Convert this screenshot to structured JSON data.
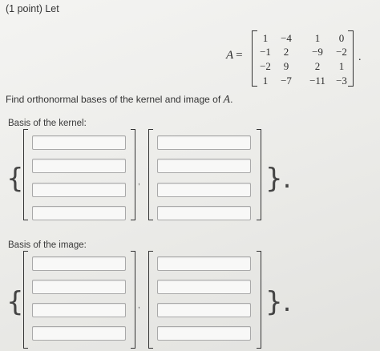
{
  "problem": {
    "header": "(1 point) Let",
    "matrix_name": "A",
    "equals": "=",
    "matrix": [
      [
        "1",
        "−4",
        "1",
        "0"
      ],
      [
        "−1",
        "2",
        "−9",
        "−2"
      ],
      [
        "−2",
        "9",
        "2",
        "1"
      ],
      [
        "1",
        "−7",
        "−11",
        "−3"
      ]
    ],
    "period": ".",
    "prompt_text": "Find orthonormal bases of the kernel and image of ",
    "prompt_var": "A",
    "prompt_end": "."
  },
  "kernel": {
    "label": "Basis of the kernel:",
    "vectors": [
      {
        "entries": [
          "",
          "",
          "",
          ""
        ]
      },
      {
        "entries": [
          "",
          "",
          "",
          ""
        ]
      }
    ],
    "separator": ",",
    "open_brace": "{",
    "close_brace": "}."
  },
  "image": {
    "label": "Basis of the image:",
    "vectors": [
      {
        "entries": [
          "",
          "",
          "",
          ""
        ]
      },
      {
        "entries": [
          "",
          "",
          "",
          ""
        ]
      }
    ],
    "separator": ",",
    "open_brace": "{",
    "close_brace": "}."
  }
}
